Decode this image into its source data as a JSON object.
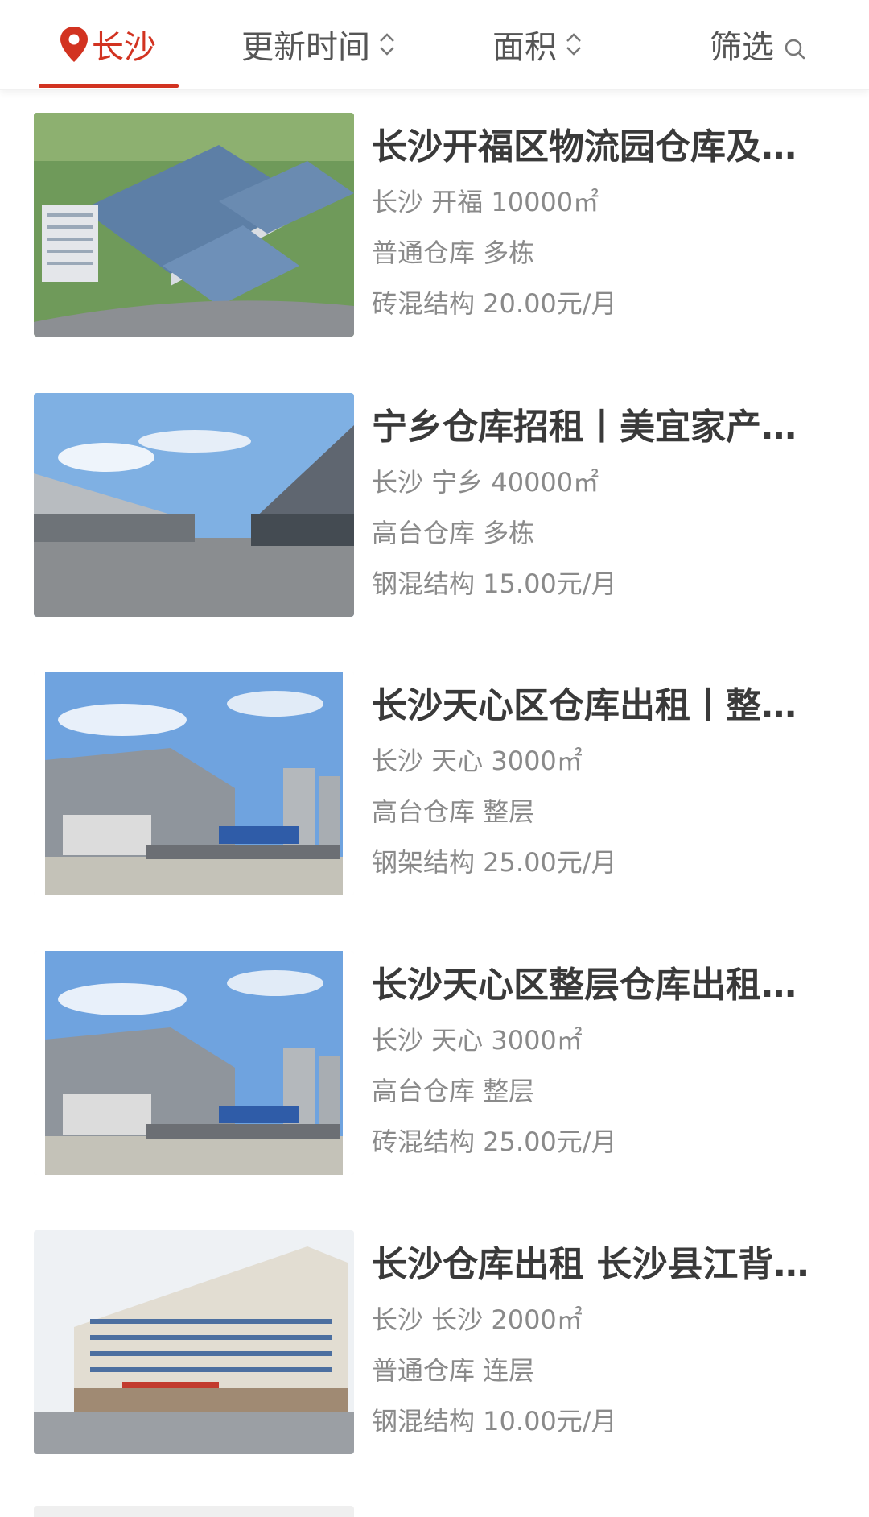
{
  "filter_bar": {
    "location": "长沙",
    "sort_update_time": "更新时间",
    "sort_area": "面积",
    "filter": "筛选",
    "accent_color": "#d23321"
  },
  "listings": [
    {
      "title": "长沙开福区物流园仓库及…",
      "location_area": "长沙 开福 10000㎡",
      "type": "普通仓库 多栋",
      "structure_price": "砖混结构 20.00元/月"
    },
    {
      "title": "宁乡仓库招租丨美宜家产…",
      "location_area": "长沙 宁乡 40000㎡",
      "type": "高台仓库 多栋",
      "structure_price": "钢混结构 15.00元/月"
    },
    {
      "title": "长沙天心区仓库出租丨整…",
      "location_area": "长沙 天心 3000㎡",
      "type": "高台仓库 整层",
      "structure_price": "钢架结构 25.00元/月"
    },
    {
      "title": "长沙天心区整层仓库出租…",
      "location_area": "长沙 天心 3000㎡",
      "type": "高台仓库 整层",
      "structure_price": "砖混结构 25.00元/月"
    },
    {
      "title": "长沙仓库出租 长沙县江背…",
      "location_area": "长沙 长沙 2000㎡",
      "type": "普通仓库 连层",
      "structure_price": "钢混结构 10.00元/月"
    }
  ]
}
